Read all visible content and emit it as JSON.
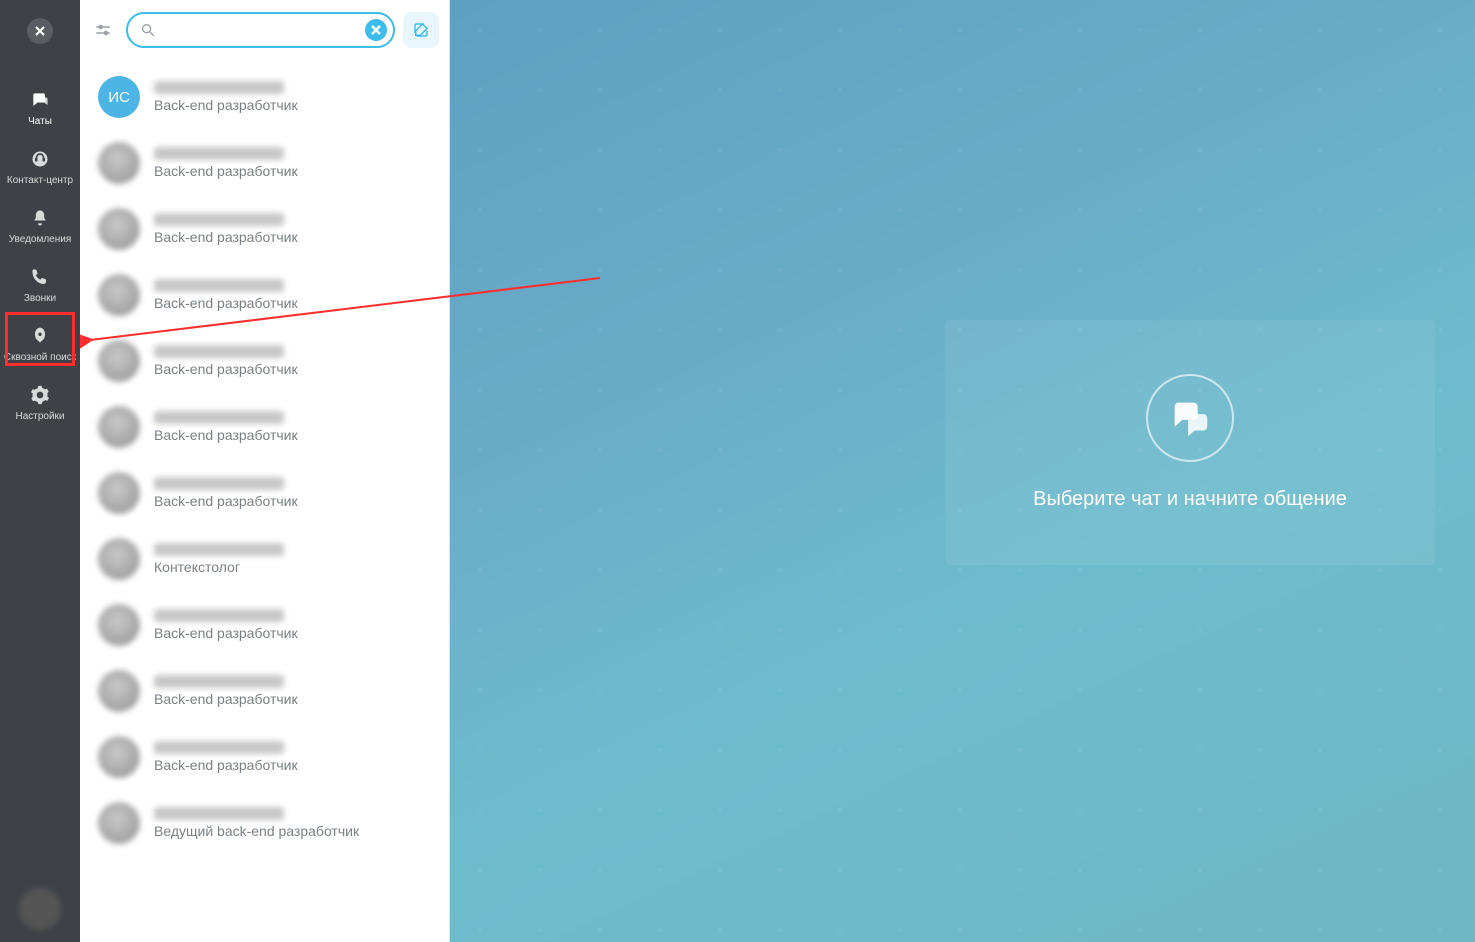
{
  "sidebar": {
    "items": [
      {
        "id": "chats",
        "label": "Чаты"
      },
      {
        "id": "contact-center",
        "label": "Контакт-центр"
      },
      {
        "id": "notifications",
        "label": "Уведомления"
      },
      {
        "id": "calls",
        "label": "Звонки"
      },
      {
        "id": "global-search",
        "label": "Сквозной поиск"
      },
      {
        "id": "settings",
        "label": "Настройки"
      }
    ],
    "highlighted_index": 4,
    "active_index": 0
  },
  "search": {
    "value": "",
    "placeholder": ""
  },
  "contacts": [
    {
      "initials": "ИС",
      "role": "Back-end разработчик"
    },
    {
      "initials": null,
      "role": "Back-end разработчик"
    },
    {
      "initials": null,
      "role": "Back-end разработчик"
    },
    {
      "initials": null,
      "role": "Back-end разработчик"
    },
    {
      "initials": null,
      "role": "Back-end разработчик"
    },
    {
      "initials": null,
      "role": "Back-end разработчик"
    },
    {
      "initials": null,
      "role": "Back-end разработчик"
    },
    {
      "initials": null,
      "role": "Контекстолог"
    },
    {
      "initials": null,
      "role": "Back-end разработчик"
    },
    {
      "initials": null,
      "role": "Back-end разработчик"
    },
    {
      "initials": null,
      "role": "Back-end разработчик"
    },
    {
      "initials": null,
      "role": "Ведущий back-end разработчик"
    }
  ],
  "empty_state": {
    "text": "Выберите чат и начните общение"
  },
  "colors": {
    "accent": "#3cbdec",
    "sidebar": "#3e4247",
    "highlight": "#ff2d2d"
  }
}
